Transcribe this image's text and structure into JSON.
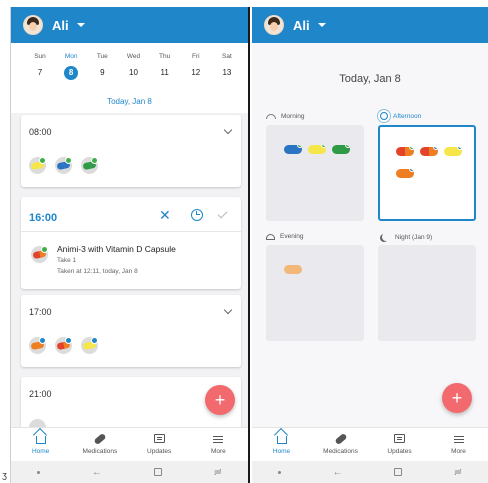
{
  "left": {
    "header": {
      "user": "Ali"
    },
    "calendar": {
      "days": [
        {
          "name": "Sun",
          "num": "7"
        },
        {
          "name": "Mon",
          "num": "8"
        },
        {
          "name": "Tue",
          "num": "9"
        },
        {
          "name": "Wed",
          "num": "10"
        },
        {
          "name": "Thu",
          "num": "11"
        },
        {
          "name": "Fri",
          "num": "12"
        },
        {
          "name": "Sat",
          "num": "13"
        }
      ],
      "selected_index": 1,
      "today_label": "Today, Jan 8"
    },
    "cards": {
      "c0800": {
        "time": "08:00"
      },
      "c1600": {
        "time": "16:00",
        "med_name": "Animi-3 with Vitamin D Capsule",
        "dose": "Take 1",
        "taken": "Taken at 12:11, today, Jan 8"
      },
      "c1700": {
        "time": "17:00"
      },
      "c2100": {
        "time": "21:00"
      }
    },
    "fab": "+"
  },
  "right": {
    "header": {
      "user": "Ali"
    },
    "date_title": "Today, Jan 8",
    "periods": {
      "morning": "Morning",
      "afternoon": "Afternoon",
      "evening": "Evening",
      "night": "Night (Jan 9)"
    },
    "fab": "+"
  },
  "nav": {
    "home": "Home",
    "medications": "Medications",
    "updates": "Updates",
    "more": "More"
  },
  "sysnav": {
    "back": "←",
    "recent": "≓"
  },
  "corner_glyph": "ʒ",
  "colors": {
    "primary": "#1f87c9",
    "fab": "#f26a6e",
    "taken_check": "#3fae49",
    "pill_orange": "#ef7d22",
    "pill_red": "#e2432a",
    "pill_yellow": "#f5e64a",
    "pill_blue": "#2b74c4",
    "pill_green": "#2f9a45",
    "pill_peach": "#f4b77a"
  }
}
